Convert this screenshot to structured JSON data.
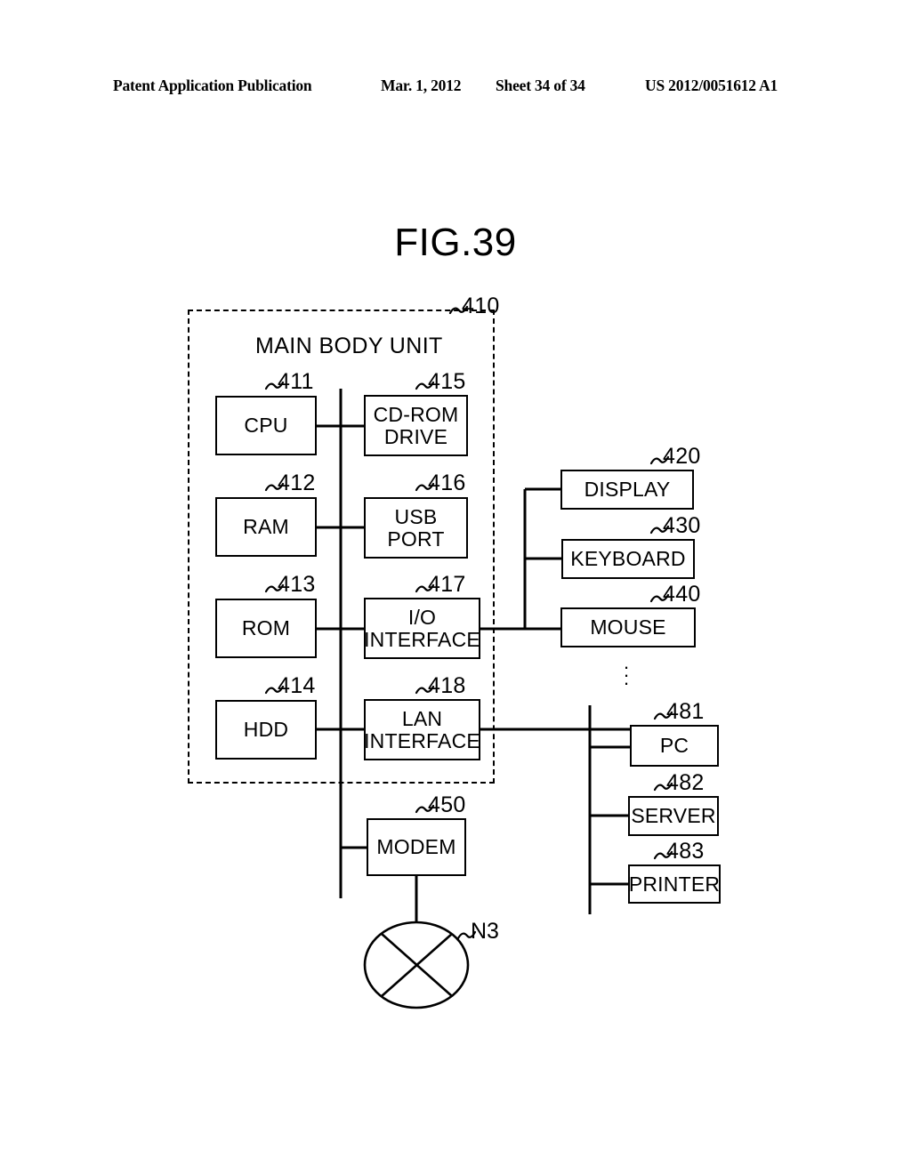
{
  "header": {
    "publication": "Patent Application Publication",
    "date": "Mar. 1, 2012",
    "sheet": "Sheet 34 of 34",
    "number": "US 2012/0051612 A1"
  },
  "figure": {
    "title": "FIG.39"
  },
  "diagram": {
    "enclosure": {
      "label": "MAIN BODY UNIT",
      "ref": "410"
    },
    "nodes": [
      {
        "id": "cpu",
        "label": "CPU",
        "ref": "411"
      },
      {
        "id": "ram",
        "label": "RAM",
        "ref": "412"
      },
      {
        "id": "rom",
        "label": "ROM",
        "ref": "413"
      },
      {
        "id": "hdd",
        "label": "HDD",
        "ref": "414"
      },
      {
        "id": "cdrom",
        "label": "CD-ROM\nDRIVE",
        "ref": "415"
      },
      {
        "id": "usb",
        "label": "USB\nPORT",
        "ref": "416"
      },
      {
        "id": "io",
        "label": "I/O\nINTERFACE",
        "ref": "417"
      },
      {
        "id": "lan",
        "label": "LAN\nINTERFACE",
        "ref": "418"
      },
      {
        "id": "display",
        "label": "DISPLAY",
        "ref": "420"
      },
      {
        "id": "keyboard",
        "label": "KEYBOARD",
        "ref": "430"
      },
      {
        "id": "mouse",
        "label": "MOUSE",
        "ref": "440"
      },
      {
        "id": "modem",
        "label": "MODEM",
        "ref": "450"
      },
      {
        "id": "pc",
        "label": "PC",
        "ref": "481"
      },
      {
        "id": "server",
        "label": "SERVER",
        "ref": "482"
      },
      {
        "id": "printer",
        "label": "PRINTER",
        "ref": "483"
      }
    ],
    "network": {
      "label": "N3"
    },
    "continuation": "⋮"
  }
}
